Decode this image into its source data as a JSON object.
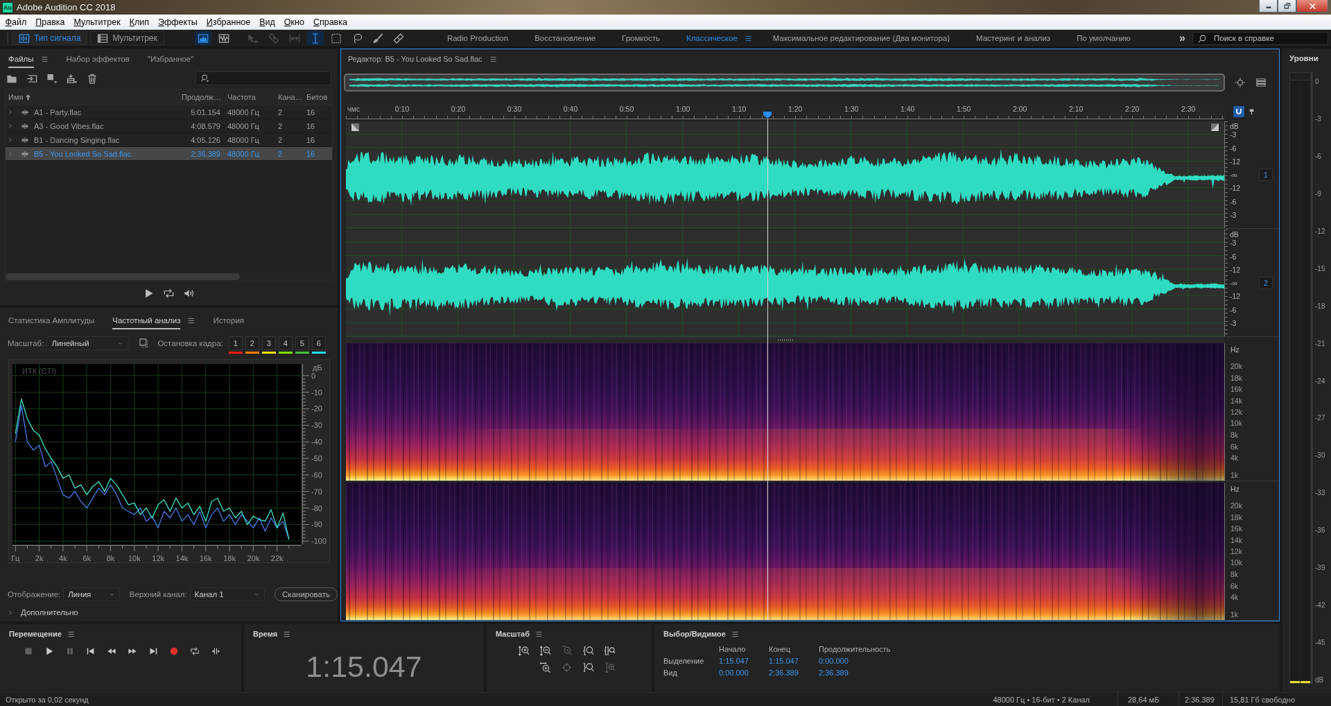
{
  "window": {
    "app_icon": "Au",
    "title": "Adobe Audition CC 2018"
  },
  "menu": [
    "Файл",
    "Правка",
    "Мультитрек",
    "Клип",
    "Эффекты",
    "Избранное",
    "Вид",
    "Окно",
    "Справка"
  ],
  "toolbar": {
    "modes": [
      {
        "label": "Тип сигнала",
        "kind": "waveform-editor",
        "selected": true
      },
      {
        "label": "Мультитрек",
        "kind": "multitrack",
        "selected": false
      }
    ],
    "views": [
      {
        "kind": "spectral",
        "selected": true
      },
      {
        "kind": "waveform",
        "selected": false
      }
    ],
    "tools": [
      {
        "kind": "move",
        "selected": false,
        "disabled": true
      },
      {
        "kind": "razor",
        "selected": false,
        "disabled": true
      },
      {
        "kind": "slip",
        "selected": false,
        "disabled": true
      },
      {
        "kind": "time-selection",
        "selected": true,
        "disabled": false
      },
      {
        "kind": "marquee",
        "selected": false,
        "disabled": false
      },
      {
        "kind": "lasso",
        "selected": false,
        "disabled": false
      },
      {
        "kind": "brush",
        "selected": false,
        "disabled": false
      },
      {
        "kind": "healing",
        "selected": false,
        "disabled": false
      }
    ],
    "workspaces": [
      {
        "label": "Radio Production",
        "selected": false
      },
      {
        "label": "Восстановление",
        "selected": false
      },
      {
        "label": "Громкость",
        "selected": false
      },
      {
        "label": "Классическое",
        "selected": true
      },
      {
        "label": "Максимальное редактирование (Два монитора)",
        "selected": false
      },
      {
        "label": "Мастеринг и анализ",
        "selected": false
      },
      {
        "label": "По умолчанию",
        "selected": false
      }
    ],
    "more": "»",
    "help_search": {
      "placeholder": "Поиск в справке"
    }
  },
  "files_panel": {
    "tabs": [
      {
        "label": "Файлы",
        "selected": true
      },
      {
        "label": "Набор эффектов",
        "selected": false
      },
      {
        "label": "\"Избранное\"",
        "selected": false
      }
    ],
    "columns": [
      "Имя",
      "Продолж…",
      "Частота",
      "Кана…",
      "Битов"
    ],
    "rows": [
      {
        "name": "A1 - Party.flac",
        "duration": "5:01.154",
        "rate": "48000 Гц",
        "channels": "2",
        "bits": "16",
        "selected": false
      },
      {
        "name": "A3 - Good Vibes.flac",
        "duration": "4:08.579",
        "rate": "48000 Гц",
        "channels": "2",
        "bits": "16",
        "selected": false
      },
      {
        "name": "B1 - Dancing Singing.flac",
        "duration": "4:05.126",
        "rate": "48000 Гц",
        "channels": "2",
        "bits": "16",
        "selected": false
      },
      {
        "name": "B5 - You Looked So Sad.flac",
        "duration": "2:36.389",
        "rate": "48000 Гц",
        "channels": "2",
        "bits": "16",
        "selected": true
      }
    ]
  },
  "frequency_panel": {
    "tabs": [
      {
        "label": "Статистика Амплитуды",
        "selected": false
      },
      {
        "label": "Частотный анализ",
        "selected": true
      },
      {
        "label": "История",
        "selected": false
      }
    ],
    "scale": {
      "label": "Масштаб:",
      "value": "Линейный"
    },
    "freeze": {
      "label": "Остановка кадра:",
      "buttons": [
        {
          "label": "1",
          "color": "#ff1a1a"
        },
        {
          "label": "2",
          "color": "#ff8000"
        },
        {
          "label": "3",
          "color": "#f0e000"
        },
        {
          "label": "4",
          "color": "#80e000"
        },
        {
          "label": "5",
          "color": "#40c040"
        },
        {
          "label": "6",
          "color": "#20e0f0"
        }
      ]
    },
    "chart_data": {
      "type": "line",
      "title": "ИТК (CTI)",
      "ylabel": "дБ",
      "x": [
        0,
        500,
        1000,
        1500,
        2000,
        2500,
        3000,
        3500,
        4000,
        4500,
        5000,
        5500,
        6000,
        6500,
        7000,
        7500,
        8000,
        8500,
        9000,
        9500,
        10000,
        10500,
        11000,
        11500,
        12000,
        12500,
        13000,
        13500,
        14000,
        14500,
        15000,
        15500,
        16000,
        16500,
        17000,
        17500,
        18000,
        18500,
        19000,
        19500,
        20000,
        20500,
        21000,
        21500,
        22000,
        22500,
        23000
      ],
      "series": [
        {
          "color": "#3ee6c8",
          "values": [
            -35,
            -14,
            -26,
            -33,
            -36,
            -44,
            -50,
            -55,
            -62,
            -60,
            -68,
            -66,
            -72,
            -67,
            -64,
            -70,
            -62,
            -66,
            -72,
            -78,
            -77,
            -84,
            -80,
            -86,
            -78,
            -75,
            -82,
            -74,
            -80,
            -77,
            -84,
            -79,
            -88,
            -76,
            -74,
            -82,
            -80,
            -86,
            -82,
            -90,
            -85,
            -87,
            -88,
            -81,
            -92,
            -83,
            -99
          ]
        },
        {
          "color": "#4a7ae8",
          "values": [
            -40,
            -18,
            -40,
            -45,
            -42,
            -55,
            -52,
            -62,
            -72,
            -74,
            -70,
            -76,
            -80,
            -74,
            -68,
            -72,
            -66,
            -72,
            -80,
            -82,
            -84,
            -80,
            -88,
            -85,
            -92,
            -82,
            -86,
            -80,
            -88,
            -84,
            -90,
            -82,
            -92,
            -84,
            -80,
            -88,
            -84,
            -90,
            -84,
            -88,
            -92,
            -86,
            -94,
            -86,
            -92,
            -88,
            -99
          ]
        }
      ],
      "xlim": [
        -250,
        24000
      ],
      "ylim": [
        -102,
        7
      ],
      "xticks": [
        {
          "value": 0,
          "label": "Гц"
        },
        {
          "value": 2000,
          "label": "2k"
        },
        {
          "value": 4000,
          "label": "4k"
        },
        {
          "value": 6000,
          "label": "6k"
        },
        {
          "value": 8000,
          "label": "8k"
        },
        {
          "value": 10000,
          "label": "10k"
        },
        {
          "value": 12000,
          "label": "12k"
        },
        {
          "value": 14000,
          "label": "14k"
        },
        {
          "value": 16000,
          "label": "16k"
        },
        {
          "value": 18000,
          "label": "18k"
        },
        {
          "value": 20000,
          "label": "20k"
        },
        {
          "value": 22000,
          "label": "22k"
        }
      ],
      "yticks": [
        0,
        -10,
        -20,
        -30,
        -40,
        -50,
        -60,
        -70,
        -80,
        -90,
        -100
      ],
      "grid": true
    },
    "display": {
      "label": "Отображение:",
      "value": "Линия"
    },
    "top_channel": {
      "label": "Верхний канал:",
      "value": "Канал 1"
    },
    "scan_button": "Сканировать",
    "advanced": {
      "label": "Дополнительно",
      "expanded": false
    }
  },
  "editor": {
    "title": "Редактор: B5 - You Looked So Sad.flac",
    "ruler": {
      "unit": "чмс",
      "ticks": [
        "0:10",
        "0:20",
        "0:30",
        "0:40",
        "0:50",
        "1:00",
        "1:10",
        "1:20",
        "1:30",
        "1:40",
        "1:50",
        "2:00",
        "2:10",
        "2:20",
        "2:30"
      ]
    },
    "playhead": {
      "level": 0.48
    },
    "waveform_channels": [
      {
        "badge": "1",
        "db_labels": [
          "dB",
          "-3",
          "-6",
          "-12",
          "-∞",
          "-12",
          "-6",
          "-3"
        ]
      },
      {
        "badge": "2",
        "db_labels": [
          "dB",
          "-3",
          "-6",
          "-12",
          "-∞",
          "-12",
          "-6",
          "-3"
        ]
      }
    ],
    "spectral_channels": [
      {
        "unit": "Hz",
        "hz_labels": [
          "20k",
          "18k",
          "16k",
          "14k",
          "12k",
          "10k",
          "8k",
          "6k",
          "4k",
          "1k"
        ]
      },
      {
        "unit": "Hz",
        "hz_labels": [
          "20k",
          "18k",
          "16k",
          "14k",
          "12k",
          "10k",
          "8k",
          "6k",
          "4k",
          "1k"
        ]
      }
    ]
  },
  "levels": {
    "title": "Уровни",
    "scale": [
      "0",
      "-3",
      "-6",
      "-9",
      "-12",
      "-15",
      "-18",
      "-21",
      "-24",
      "-27",
      "-30",
      "-33",
      "-36",
      "-39",
      "-42",
      "-45",
      "dB"
    ],
    "meters": [
      {
        "level": 0.003
      },
      {
        "level": 0.003
      }
    ]
  },
  "transport": {
    "title": "Перемещение",
    "buttons": [
      {
        "kind": "stop",
        "disabled": true
      },
      {
        "kind": "play",
        "disabled": false
      },
      {
        "kind": "pause",
        "disabled": true
      },
      {
        "kind": "to-start",
        "disabled": false
      },
      {
        "kind": "rewind",
        "disabled": false
      },
      {
        "kind": "forward",
        "disabled": false
      },
      {
        "kind": "to-end",
        "disabled": false
      },
      {
        "kind": "record",
        "disabled": false
      },
      {
        "kind": "loop",
        "disabled": false
      },
      {
        "kind": "skip",
        "disabled": false
      }
    ]
  },
  "time": {
    "title": "Время",
    "value": "1:15.047"
  },
  "zoom": {
    "title": "Масштаб",
    "rows": [
      {
        "buttons": [
          {
            "kind": "amp-in",
            "disabled": false
          },
          {
            "kind": "amp-out",
            "disabled": false
          },
          {
            "kind": "full",
            "disabled": true
          },
          {
            "kind": "in-point",
            "disabled": false
          },
          {
            "kind": "both-points",
            "disabled": false
          }
        ]
      },
      {
        "buttons": [
          {
            "kind": "time-in",
            "disabled": false
          },
          {
            "kind": "selection",
            "disabled": true
          },
          {
            "kind": "out-point",
            "disabled": false
          },
          {
            "kind": "track-in",
            "disabled": true
          }
        ]
      }
    ]
  },
  "selection": {
    "title": "Выбор/Видимое",
    "columns": [
      "Начало",
      "Конец",
      "Продолжительность"
    ],
    "rows": [
      {
        "label": "Выделение",
        "values": [
          "1:15.047",
          "1:15.047",
          "0:00.000"
        ]
      },
      {
        "label": "Вид",
        "values": [
          "0:00.000",
          "2:36.389",
          "2:36.389"
        ]
      }
    ]
  },
  "status_bar": {
    "message": "Открыто за 0,02 секунд",
    "format": "48000 Гц • 16-бит • 2 Канал",
    "size": "28,64 мБ",
    "duration": "2:36.389",
    "free_space": "15,81 Гб свободно"
  }
}
